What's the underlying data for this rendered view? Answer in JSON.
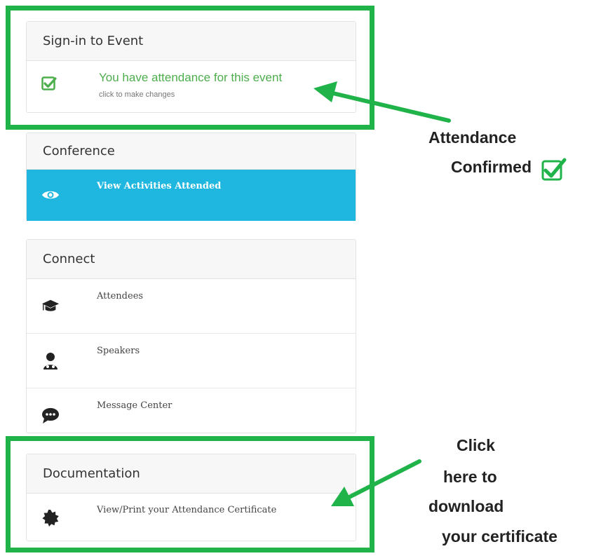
{
  "signin": {
    "title": "Sign-in to Event",
    "status": "You have attendance for this event",
    "hint": "click to make changes"
  },
  "conference": {
    "title": "Conference",
    "item_label": "View Activities Attended"
  },
  "connect": {
    "title": "Connect",
    "items": [
      {
        "label": "Attendees",
        "icon": "graduation-cap-icon"
      },
      {
        "label": "Speakers",
        "icon": "user-doctor-icon"
      },
      {
        "label": "Message Center",
        "icon": "chat-bubble-icon"
      }
    ]
  },
  "documentation": {
    "title": "Documentation",
    "item_label": "View/Print your Attendance Certificate"
  },
  "annotations": {
    "attendance_line1": "Attendance",
    "attendance_line2": "Confirmed",
    "click_line1": "Click",
    "click_line2": "here to",
    "click_line3": "download",
    "click_line4": "your  certificate"
  },
  "colors": {
    "highlight_green": "#1fb34a",
    "conference_blue": "#1fb6e0",
    "status_green": "#4cae4c"
  }
}
